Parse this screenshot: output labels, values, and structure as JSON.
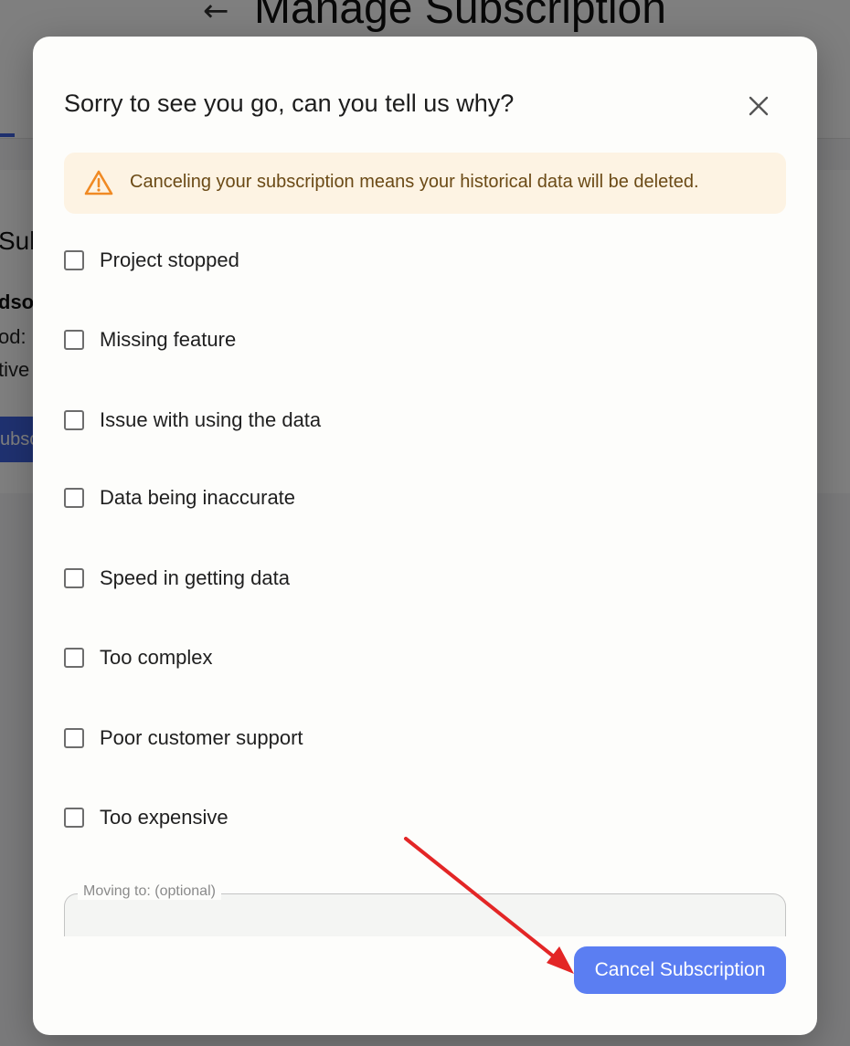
{
  "background": {
    "back_icon": "arrow-left-icon",
    "page_title": "Manage Subscription",
    "section_title_fragment": "Sub",
    "bold_fragment": "dso",
    "line1_fragment": "od:",
    "line2_fragment": "tive",
    "button_fragment": "ubsc"
  },
  "modal": {
    "title": "Sorry to see you go, can you tell us why?",
    "close_icon": "close-icon",
    "alert": {
      "icon": "warning-triangle-icon",
      "text": "Canceling your subscription means your historical data will be deleted.",
      "color": "#f08a24",
      "background": "#fdf3e3"
    },
    "options": [
      {
        "label": "Project stopped",
        "checked": false
      },
      {
        "label": "Missing feature",
        "checked": false
      },
      {
        "label": "Issue with using the data",
        "checked": false
      },
      {
        "label": "Data being inaccurate",
        "checked": false
      },
      {
        "label": "Speed in getting data",
        "checked": false
      },
      {
        "label": "Too complex",
        "checked": false
      },
      {
        "label": "Poor customer support",
        "checked": false
      },
      {
        "label": "Too expensive",
        "checked": false
      }
    ],
    "moving_to": {
      "label": "Moving to: (optional)",
      "value": ""
    },
    "cancel_button": {
      "label": "Cancel Subscription",
      "color": "#5b7ef2"
    }
  },
  "annotation": {
    "arrow_color": "#e32626"
  }
}
